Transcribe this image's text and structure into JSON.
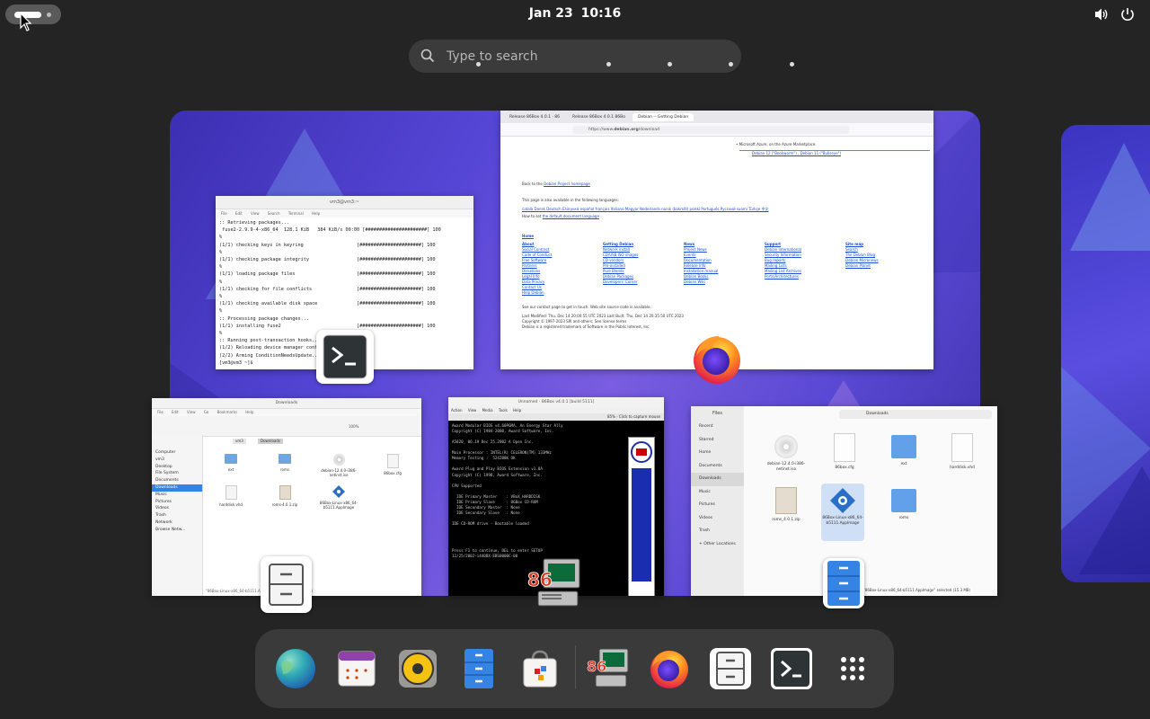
{
  "topbar": {
    "date": "Jan 23",
    "time": "10:16",
    "icons": [
      "volume-icon",
      "power-icon"
    ]
  },
  "search": {
    "placeholder": "Type to search"
  },
  "windows": {
    "terminal": {
      "title": "vm3@vm3:~",
      "menu": [
        "File",
        "Edit",
        "View",
        "Search",
        "Terminal",
        "Help"
      ],
      "lines": [
        ":: Retrieving packages...",
        " fuse2-2.9.9-4-x86_64  128.1 KiB   384 KiB/s 00:00 [######################] 100",
        "%",
        "(1/1) checking keys in keyring                   [######################] 100",
        "%",
        "(1/1) checking package integrity                 [######################] 100",
        "%",
        "(1/1) loading package files                      [######################] 100",
        "%",
        "(1/1) checking for file conflicts                [######################] 100",
        "%",
        "(1/1) checking available disk space              [######################] 100",
        "%",
        ":: Processing package changes...",
        "(1/1) installing fuse2                           [######################] 100",
        "%",
        ":: Running post-transaction hooks...",
        "(1/2) Reloading device manager configuration...",
        "(2/2) Arming ConditionNeedsUpdate...",
        "[vm3@vm3 ~]$ "
      ]
    },
    "firefox": {
      "tabs": [
        "Release 86Box 4.0.1 · 86",
        "Release 86Box 4.0.1 86Bo",
        "Debian -- Getting Debian"
      ],
      "url_prefix": "https://www.",
      "url_domain": "debian.org",
      "url_suffix": "/download",
      "azure_line": "• Microsoft Azure, on the Azure Marketplace.",
      "azure_links": "Debian 12 (\"Bookworm\") , Debian 11 (\"Bullseye\")",
      "back_prefix": "Back to the ",
      "back_link": "Debian Project homepage",
      "lang_line": "This page is also available in the following languages:",
      "languages": "català  Dansk  Deutsch  Ελληνικά  español  français  Italiano  Magyar  Nederlands  norsk (bokmål)  polski  Português  Русский  suomi  Türkçe  中文",
      "howto_prefix": "How to set ",
      "howto_link": "the default document language",
      "home": "Home",
      "cols": [
        [
          "About",
          "Social Contract",
          "Code of Conduct",
          "Free Software",
          "Partners",
          "Donations",
          "Legal Info",
          "Data Privacy",
          "Contact Us",
          "Help Debian"
        ],
        [
          "Getting Debian",
          "Network install",
          "CD/USB ISO images",
          "CD vendors",
          "Pre-installed",
          "Pure Blends",
          "Debian Packages",
          "Developers' Corner"
        ],
        [
          "News",
          "Project News",
          "Events",
          "Documentation",
          "Release Info",
          "Installation manual",
          "Debian Books",
          "Debian Wiki"
        ],
        [
          "Support",
          "Debian International",
          "Security Information",
          "Bug reports",
          "Mailing Lists",
          "Mailing List Archives",
          "Ports/Architectures"
        ],
        [
          "Site map",
          "Search",
          "The Debian Blog",
          "Debian Micronews",
          "Debian Planet"
        ]
      ],
      "footer": [
        "See our contact page to get in touch. Web site source code is available.",
        "Last Modified: Thu, Dec 14 20:00:55 UTC 2023    Last Built: Thu, Dec 14 20:35:50 UTC 2023",
        "Copyright © 1997-2023 SPI and others; See license terms",
        "Debian is a registered trademark of Software in the Public Interest, Inc."
      ]
    },
    "files_old": {
      "title": "Downloads",
      "menu": [
        "File",
        "Edit",
        "View",
        "Go",
        "Bookmarks",
        "Help"
      ],
      "zoom": "100%",
      "path": [
        "vm3",
        "Downloads"
      ],
      "places_hdr": "Places",
      "sidebar": [
        "Computer",
        "vm3",
        "Desktop",
        "File System",
        "Documents",
        "Downloads",
        "Music",
        "Pictures",
        "Videos",
        "Trash",
        "Network",
        "Browse Netw..."
      ],
      "items": [
        "ext",
        "roms",
        "debian-12.4.0-i386-netinst.iso",
        "86box.cfg",
        "harddisk.vhd",
        "roms-4.0.1.zip",
        "86Box-Linux-x86_64-b5111.AppImage"
      ],
      "status": "\"86Box-Linux-x86_64-b5111.AppImage\" selected (15.3 MB)"
    },
    "box86": {
      "title": "Unnamed - 86Box v4.0.1 [build 5111]",
      "menu": [
        "Action",
        "View",
        "Media",
        "Tools",
        "Help"
      ],
      "toolbar_hint": "85% - Click to capture mouse",
      "bios": [
        "Award Modular BIOS v4.60PGMA, An Energy Star Ally",
        "Copyright (C) 1984-2000, Award Software, Inc.",
        "",
        "A5020_ 06.19 Dec 25.2002 A Open Inc.",
        "",
        "Main Processor : INTEL(R) CELERON(TM) 133MHz",
        "Memory Testing :  524288K OK",
        "",
        "Award Plug and Play BIOS Extension v1.0A",
        "Copyright (C) 1998, Award Software, Inc.",
        "",
        "CPU Supported",
        "",
        "  IDE Primary Master    : VBoX_HARDDISK",
        "  IDE Primary Slave     : 86Box CD-ROM",
        "  IDE Secondary Master  : None",
        "  IDE Secondary Slave   : None",
        "",
        "IDE CD-ROM drive - Bootable loaded",
        "",
        "",
        "",
        "",
        "Press F1 to continue, DEL to enter SETUP",
        "12/25/2002-i440BX-EBS0000C-00"
      ],
      "logo_text": "http://www.aopen.com",
      "brand": "AOpen"
    },
    "files_new": {
      "title": "Files",
      "path": "Downloads",
      "sidebar": [
        "Recent",
        "Starred",
        "Home",
        "Documents",
        "Downloads",
        "Music",
        "Pictures",
        "Videos",
        "Trash",
        "+ Other Locations"
      ],
      "items": [
        "debian-12.4.0-i386-netinst.iso",
        "86box.cfg",
        "ext",
        "harddisk.vhd",
        "roms_4.0.1.zip",
        "86Box-Linux-x86_64-b5111.AppImage",
        "roms"
      ],
      "status": "\"86Box-Linux-x86_64-b5111.AppImage\" selected (15.3 MB)"
    }
  },
  "dash": {
    "apps": [
      {
        "name": "Web",
        "icon": "globe-icon",
        "running": false
      },
      {
        "name": "Calendar",
        "icon": "calendar-icon",
        "running": false
      },
      {
        "name": "Rhythmbox",
        "icon": "music-player-icon",
        "running": false
      },
      {
        "name": "Files",
        "icon": "files-icon",
        "running": true
      },
      {
        "name": "Software",
        "icon": "software-bag-icon",
        "running": false
      },
      {
        "name": "86Box",
        "icon": "86box-icon",
        "running": true
      },
      {
        "name": "Firefox",
        "icon": "firefox-icon",
        "running": true
      },
      {
        "name": "File Manager",
        "icon": "file-cabinet-icon",
        "running": true
      },
      {
        "name": "Terminal",
        "icon": "terminal-icon",
        "running": true
      },
      {
        "name": "Show Applications",
        "icon": "app-grid-icon",
        "running": false
      }
    ]
  },
  "colors": {
    "background": "#242424",
    "accent": "#3584e4",
    "workspace": "#5646d6"
  }
}
